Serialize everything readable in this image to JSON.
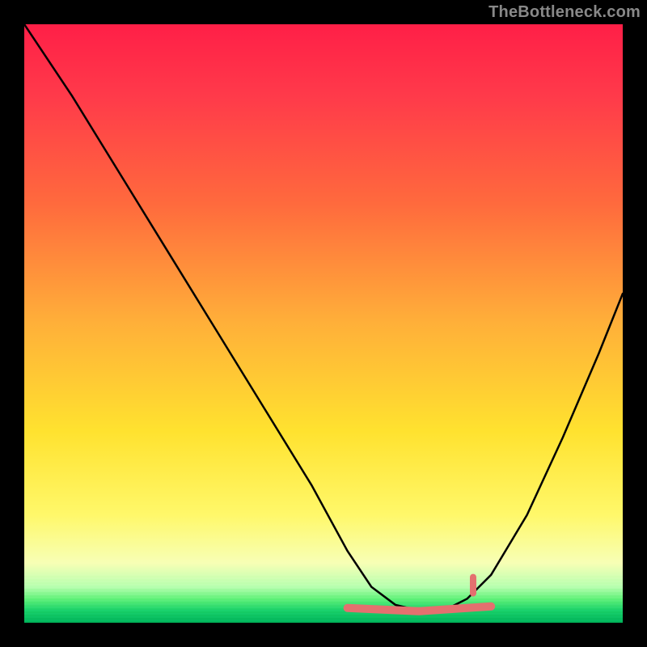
{
  "watermark": "TheBottleneck.com",
  "chart_data": {
    "type": "line",
    "title": "",
    "xlabel": "",
    "ylabel": "",
    "xlim": [
      0,
      100
    ],
    "ylim": [
      0,
      100
    ],
    "grid": false,
    "legend": {
      "position": "none"
    },
    "background_gradient": {
      "stops": [
        {
          "pos": 0.0,
          "color": "#ff1f47"
        },
        {
          "pos": 0.12,
          "color": "#ff3a4a"
        },
        {
          "pos": 0.3,
          "color": "#ff6a3d"
        },
        {
          "pos": 0.5,
          "color": "#ffb039"
        },
        {
          "pos": 0.68,
          "color": "#ffe22f"
        },
        {
          "pos": 0.82,
          "color": "#fff86a"
        },
        {
          "pos": 0.9,
          "color": "#f7ffb5"
        },
        {
          "pos": 0.94,
          "color": "#b8ffb0"
        },
        {
          "pos": 0.96,
          "color": "#62f27a"
        },
        {
          "pos": 0.98,
          "color": "#18d06a"
        },
        {
          "pos": 1.0,
          "color": "#00b45a"
        }
      ]
    },
    "series": [
      {
        "name": "bottleneck-curve",
        "color": "#000000",
        "x": [
          0,
          8,
          16,
          24,
          32,
          40,
          48,
          54,
          58,
          62,
          66,
          70,
          74,
          78,
          84,
          90,
          96,
          100
        ],
        "values": [
          100,
          88,
          75,
          62,
          49,
          36,
          23,
          12,
          6,
          3,
          2,
          2,
          4,
          8,
          18,
          31,
          45,
          55
        ]
      }
    ],
    "annotations": {
      "flat_zone": {
        "name": "optimal-range-marker",
        "color": "#e4706f",
        "x_start": 54,
        "x_end": 78,
        "y": 3
      },
      "tick_mark": {
        "name": "optimal-point-tick",
        "color": "#e4706f",
        "x": 75,
        "y": 6
      }
    }
  }
}
